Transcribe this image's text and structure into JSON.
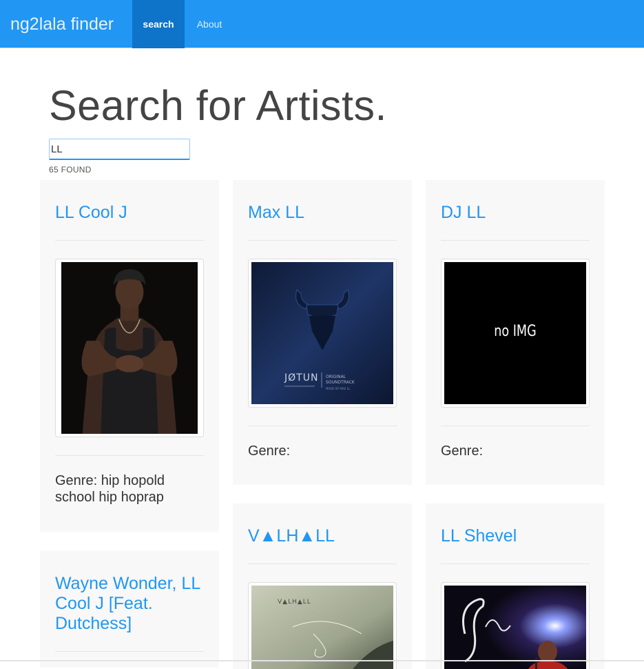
{
  "nav": {
    "brand": "ng2lala finder",
    "items": [
      {
        "label": "search",
        "active": true
      },
      {
        "label": "About",
        "active": false
      }
    ]
  },
  "page_title": "Search for Artists.",
  "search": {
    "value": "LL",
    "placeholder": ""
  },
  "found_text": "65 FOUND",
  "colors": {
    "primary": "#2196f3",
    "nav_active": "#0d74c9",
    "card_bg": "#f8f8f8"
  },
  "cards": [
    {
      "name": "LL Cool J",
      "image": "artist-photo",
      "genre": "Genre: hip hopold school hip hoprap"
    },
    {
      "name": "Max LL",
      "image": "jotun-album-cover",
      "genre": "Genre:"
    },
    {
      "name": "DJ LL",
      "image": "no-image-placeholder",
      "image_text": "no IMG",
      "genre": "Genre:"
    },
    {
      "name": "Wayne Wonder, LL Cool J [Feat. Dutchess]"
    },
    {
      "name": "V▲LH▲LL",
      "image": "valhall-album-cover"
    },
    {
      "name": "LL Shevel",
      "image": "shevel-artist-photo"
    }
  ]
}
